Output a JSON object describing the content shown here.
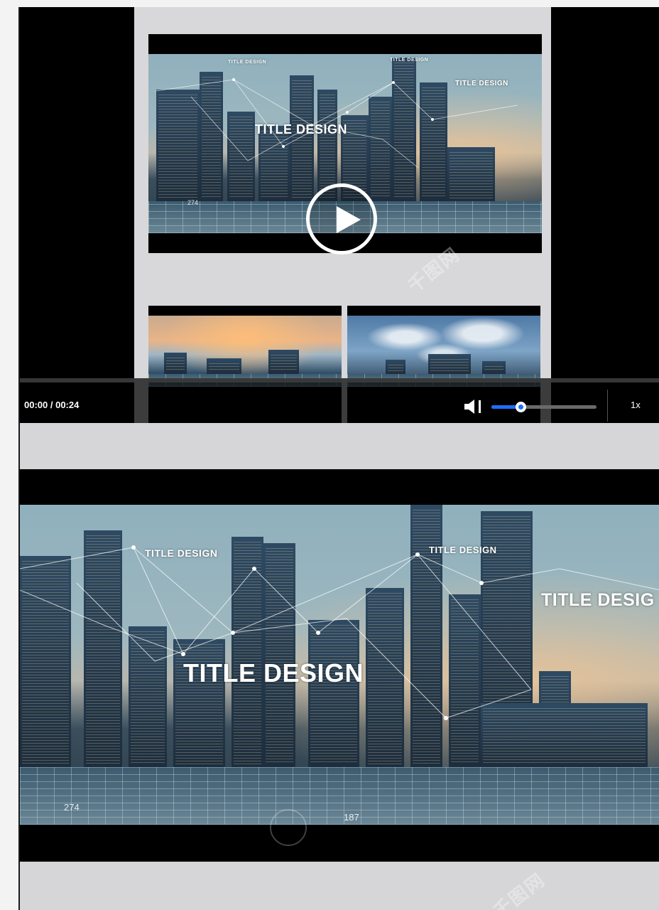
{
  "player_top": {
    "hero": {
      "title": "TITLE DESIGN",
      "tag_left": "TITLE DESIGN",
      "tag_mid": "TITLE DESIGN",
      "tag_right": "TITLE DESIGN",
      "number_label": "274"
    },
    "controls": {
      "time": "00:00 / 00:24",
      "volume_level": 0.28,
      "speed": "1x"
    }
  },
  "player_bottom": {
    "title": "TITLE DESIGN",
    "tag_left": "TITLE DESIGN",
    "tag_mid": "TITLE DESIGN",
    "tag_right": "TITLE DESIG",
    "numbers": [
      "274",
      "187"
    ]
  },
  "watermark": "千图网"
}
